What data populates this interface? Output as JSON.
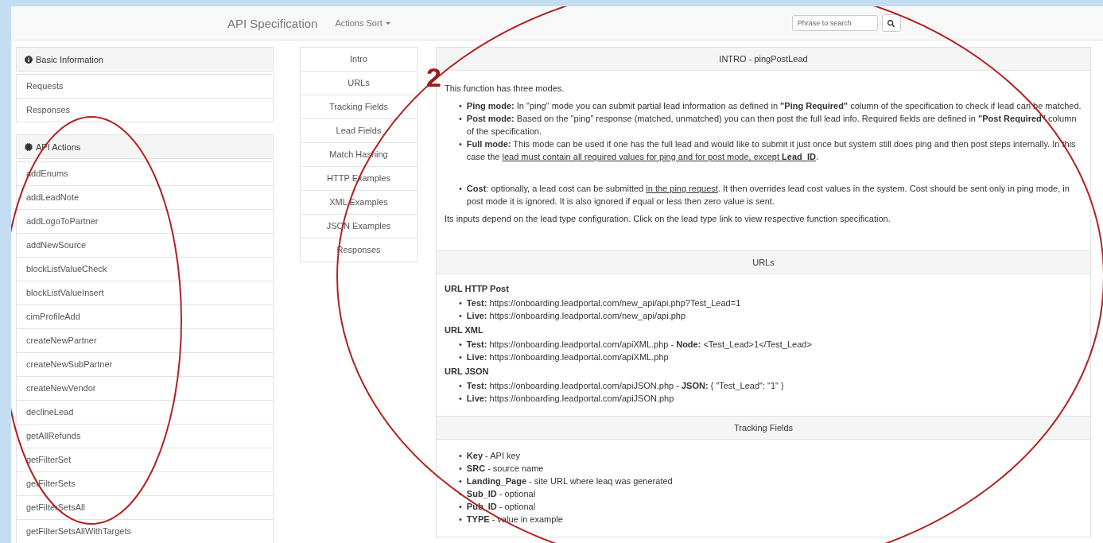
{
  "navbar": {
    "brand": "API Specification",
    "menu": {
      "label": "Actions Sort"
    },
    "search": {
      "placeholder": "Phrase to search"
    }
  },
  "sidebar": {
    "sections": [
      {
        "title": "Basic Information",
        "items": [
          "Requests",
          "Responses"
        ]
      },
      {
        "title": "API Actions",
        "items": [
          "addEnums",
          "addLeadNote",
          "addLogoToPartner",
          "addNewSource",
          "blockListValueCheck",
          "blockListValueInsert",
          "cimProfileAdd",
          "createNewPartner",
          "createNewSubPartner",
          "createNewVendor",
          "declineLead",
          "getAllRefunds",
          "getFilterSet",
          "getFilterSets",
          "getFilterSetsAll",
          "getFilterSetsAllWithTargets"
        ]
      }
    ]
  },
  "section_nav": [
    "Intro",
    "URLs",
    "Tracking Fields",
    "Lead Fields",
    "Match Hashing",
    "HTTP Examples",
    "XML Examples",
    "JSON Examples",
    "Responses"
  ],
  "panels": [
    {
      "title": "INTRO - pingPostLead",
      "blocks": [
        {
          "kind": "paragraph",
          "text": "This function has three modes."
        },
        {
          "kind": "list",
          "items": [
            {
              "marker": "•",
              "parts": [
                {
                  "text": "**Ping mode:** In \"ping\" mode you can submit partial lead information as defined in **\"Ping Required\"** column of the specification to check if lead can be matched."
                }
              ]
            },
            {
              "marker": "•",
              "parts": [
                {
                  "text": "**Post mode:** Based on the \"ping\" response (matched, unmatched) you can then post the full lead info. Required fields are defined in **\"Post Required\"** column of the specification."
                }
              ]
            },
            {
              "marker": "•",
              "parts": [
                {
                  "text": "**Full mode:** This mode can be used if one has the full lead and would like to submit it just once but system still does ping and then post steps internally. In this case the "
                },
                {
                  "text": "lead must contain all required values for ping and for post mode, except **Lead_ID**",
                  "link": true
                },
                {
                  "text": "."
                }
              ]
            }
          ]
        },
        {
          "kind": "spacer"
        },
        {
          "kind": "list",
          "items": [
            {
              "marker": "•",
              "parts": [
                {
                  "text": "**Cost**: optionally, a lead cost can be submitted "
                },
                {
                  "text": "in the ping request",
                  "link": true
                },
                {
                  "text": ". It then overrides lead cost values in the system. Cost should be sent only in ping mode, in post mode it is ignored. It is also ignored if equal or less then zero value is sent."
                }
              ]
            }
          ]
        },
        {
          "kind": "paragraph",
          "text": "Its inputs depend on the lead type configuration. Click on the lead type link to view respective function specification."
        },
        {
          "kind": "spacer"
        }
      ]
    },
    {
      "title": "URLs",
      "blocks": [
        {
          "kind": "heading",
          "text": "URL HTTP Post"
        },
        {
          "kind": "list",
          "items": [
            {
              "marker": "•",
              "parts": [
                {
                  "text": "**Test:** https://onboarding.leadportal.com/new_api/api.php?Test_Lead=1"
                }
              ]
            },
            {
              "marker": "•",
              "parts": [
                {
                  "text": "**Live:** https://onboarding.leadportal.com/new_api/api.php"
                }
              ]
            }
          ]
        },
        {
          "kind": "heading",
          "text": "URL XML"
        },
        {
          "kind": "list",
          "items": [
            {
              "marker": "•",
              "parts": [
                {
                  "text": "**Test:** https://onboarding.leadportal.com/apiXML.php - **Node:** <Test_Lead>1</Test_Lead>"
                }
              ]
            },
            {
              "marker": "•",
              "parts": [
                {
                  "text": "**Live:** https://onboarding.leadportal.com/apiXML.php"
                }
              ]
            }
          ]
        },
        {
          "kind": "heading",
          "text": "URL JSON"
        },
        {
          "kind": "list",
          "items": [
            {
              "marker": "•",
              "parts": [
                {
                  "text": "**Test:** https://onboarding.leadportal.com/apiJSON.php - **JSON:** { \"Test_Lead\": \"1\" }"
                }
              ]
            },
            {
              "marker": "•",
              "parts": [
                {
                  "text": "**Live:** https://onboarding.leadportal.com/apiJSON.php"
                }
              ]
            }
          ]
        }
      ]
    },
    {
      "title": "Tracking Fields",
      "blocks": [
        {
          "kind": "list",
          "items": [
            {
              "marker": "•",
              "parts": [
                {
                  "text": "**Key** - API key"
                }
              ]
            },
            {
              "marker": "•",
              "parts": [
                {
                  "text": "**SRC** - source name"
                }
              ]
            },
            {
              "marker": "•",
              "parts": [
                {
                  "text": "**Landing_Page** - site URL where leaq was generated"
                }
              ]
            },
            {
              "marker": "•",
              "parts": [
                {
                  "text": "**Sub_ID** - optional"
                }
              ]
            },
            {
              "marker": "•",
              "parts": [
                {
                  "text": "**Pub_ID** - optional"
                }
              ]
            },
            {
              "marker": "•",
              "parts": [
                {
                  "text": "**TYPE** - value in example"
                }
              ]
            }
          ]
        }
      ]
    }
  ],
  "annotations": [
    {
      "label": "2"
    }
  ]
}
